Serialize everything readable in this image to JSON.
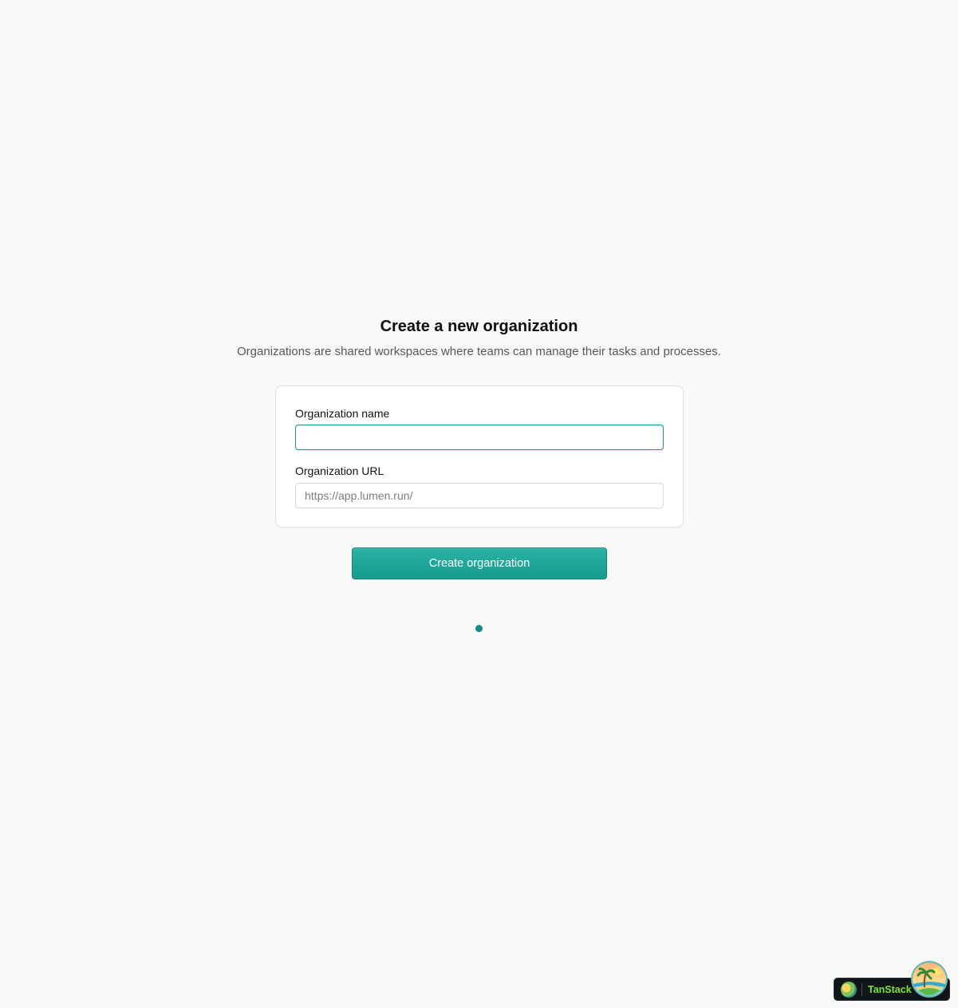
{
  "header": {
    "title": "Create a new organization",
    "subtitle": "Organizations are shared workspaces where teams can manage their tasks and processes."
  },
  "form": {
    "name_label": "Organization name",
    "name_value": "",
    "url_label": "Organization URL",
    "url_placeholder": "https://app.lumen.run/",
    "url_value": ""
  },
  "actions": {
    "submit_label": "Create organization"
  },
  "devtools": {
    "label": "TanStack",
    "logo_icon": "tanstack-island-logo-icon"
  },
  "colors": {
    "accent": "#179b8f",
    "background": "#f9f9f8",
    "devtools_text": "#7ee33a"
  }
}
